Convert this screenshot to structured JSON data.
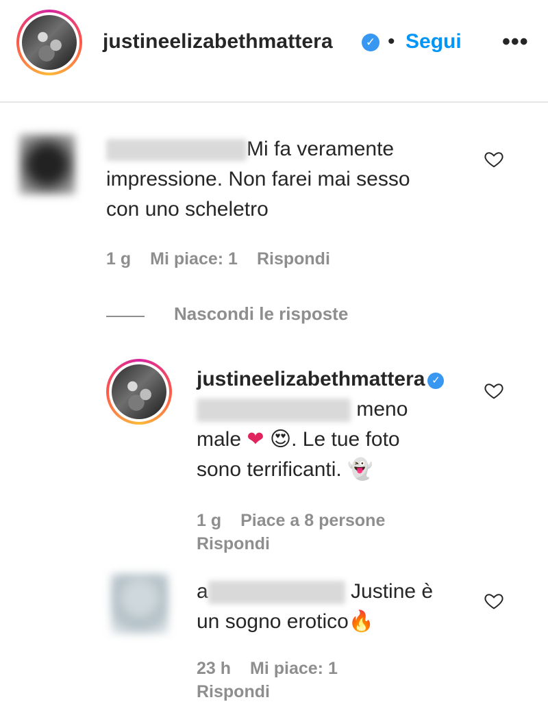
{
  "header": {
    "username": "justineelizabethmattera",
    "verified_icon": "verified-badge-icon",
    "separator": "•",
    "follow_label": "Segui",
    "more_label": "•••"
  },
  "comment1": {
    "text_line1": "Mi fa veramente",
    "text_line2": "impressione. Non farei mai sesso",
    "text_line3": "con uno scheletro",
    "time": "1 g",
    "likes": "Mi piace: 1",
    "reply": "Rispondi",
    "hide_replies": "Nascondi le risposte"
  },
  "reply1": {
    "username": "justineelizabethmattera",
    "text_line1_suffix": "meno",
    "text_line2_a": "male",
    "heart_emoji": "❤",
    "love_emoji": "😍",
    "text_line2_b": ". Le tue foto",
    "text_line3": "sono terrificanti.",
    "ghost_emoji": "👻",
    "time": "1 g",
    "likes": "Piace a 8 persone",
    "reply": "Rispondi"
  },
  "reply2": {
    "name_prefix": "a",
    "text_line1_suffix": "Justine è",
    "text_line2": "un sogno erotico",
    "fire_emoji": "🔥",
    "time": "23 h",
    "likes": "Mi piace: 1",
    "reply": "Rispondi"
  },
  "colors": {
    "accent": "#0095f6",
    "verified": "#3897f0",
    "muted": "#8e8e8e",
    "text": "#262626"
  }
}
